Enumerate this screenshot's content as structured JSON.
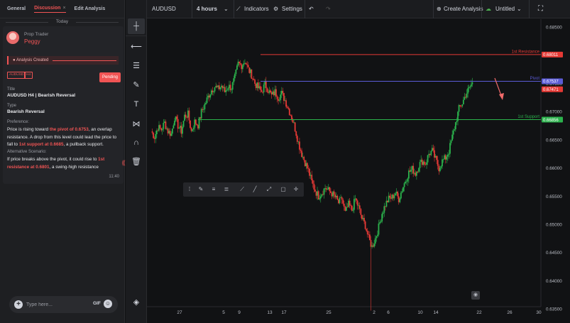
{
  "left": {
    "tabs": [
      {
        "label": "General"
      },
      {
        "label": "Discussion",
        "close": "×"
      },
      {
        "label": "Edit Analysis"
      }
    ],
    "day_separator": "Today",
    "message": {
      "role": "Prop Trader",
      "username": "Peggy",
      "event": "Analysis Created",
      "tags": [
        "AUDUSD",
        "H4"
      ],
      "status": "Pending",
      "title_label": "Title",
      "title": "AUDUSD H4 | Bearish Reversal",
      "type_label": "Type",
      "type": "Bearish Reversal",
      "preference_label": "Preference:",
      "preference": {
        "t1": "Price is rising toward ",
        "h1": "the pivot of 0.6753",
        "t2": ", an overlap resistance. A drop from this level could lead the price to fall to ",
        "h2": "1st support at 0.6685",
        "t3": ", a pullback support."
      },
      "alt_label": "Alternative Scenario:",
      "alternative": {
        "t1": "If price breaks above the pivot, it could rise to ",
        "h1": "1st resistance at 0.6801",
        "t2": ", a swing-high resistance"
      },
      "time": "11:40"
    },
    "composer": {
      "placeholder": "Type here...",
      "gif": "GIF"
    }
  },
  "toolbar": {
    "symbol": "AUDUSD",
    "interval": "4 hours",
    "indicators": "Indicators",
    "settings": "Settings",
    "create_analysis": "Create Analysis",
    "layout_name": "Untitled"
  },
  "chart_data": {
    "type": "candlestick",
    "symbol": "AUDUSD",
    "interval": "4 hours",
    "ylim": [
      0.6325,
      0.6855
    ],
    "y_ticks": [
      "0.68500",
      "0.68000",
      "0.67500",
      "0.67000",
      "0.66500",
      "0.66000",
      "0.65500",
      "0.65000",
      "0.64500",
      "0.64000",
      "0.63500"
    ],
    "x_ticks": [
      "27",
      "5",
      "9",
      "13",
      "17",
      "25",
      "2",
      "6",
      "10",
      "14",
      "22",
      "26",
      "30"
    ],
    "levels": [
      {
        "name": "1st Resistance",
        "value": 0.68011,
        "label": "0.68011",
        "color": "#e53935"
      },
      {
        "name": "Pivot",
        "value": 0.67537,
        "label": "0.67537",
        "color": "#5b5bd6"
      },
      {
        "name": "",
        "value": 0.67471,
        "label": "0.67471",
        "color": "#e53935"
      },
      {
        "name": "1st Support",
        "value": 0.66856,
        "label": "0.66856",
        "color": "#2bb24c"
      }
    ],
    "price_path": [
      0.6665,
      0.6655,
      0.6672,
      0.6668,
      0.668,
      0.6665,
      0.666,
      0.669,
      0.6675,
      0.6665,
      0.6692,
      0.6695,
      0.6665,
      0.6682,
      0.6676,
      0.6699,
      0.6712,
      0.6726,
      0.6738,
      0.6744,
      0.674,
      0.6746,
      0.6735,
      0.6745,
      0.6742,
      0.676,
      0.6785,
      0.6782,
      0.679,
      0.6775,
      0.6765,
      0.675,
      0.6742,
      0.6735,
      0.6748,
      0.6738,
      0.6728,
      0.6735,
      0.6725,
      0.6732,
      0.672,
      0.6705,
      0.669,
      0.667,
      0.6645,
      0.6625,
      0.661,
      0.6595,
      0.6575,
      0.656,
      0.655,
      0.6556,
      0.6565,
      0.656,
      0.6555,
      0.6548,
      0.6538,
      0.6545,
      0.652,
      0.6535,
      0.6525,
      0.6545,
      0.653,
      0.651,
      0.6498,
      0.6475,
      0.646,
      0.6475,
      0.6495,
      0.652,
      0.6535,
      0.6545,
      0.6548,
      0.6556,
      0.6545,
      0.6562,
      0.6578,
      0.6592,
      0.6598,
      0.659,
      0.6605,
      0.6612,
      0.6608,
      0.6625,
      0.663,
      0.6615,
      0.66,
      0.6612,
      0.6618,
      0.663,
      0.6655,
      0.668,
      0.6705,
      0.6715,
      0.673,
      0.674,
      0.6752
    ]
  }
}
